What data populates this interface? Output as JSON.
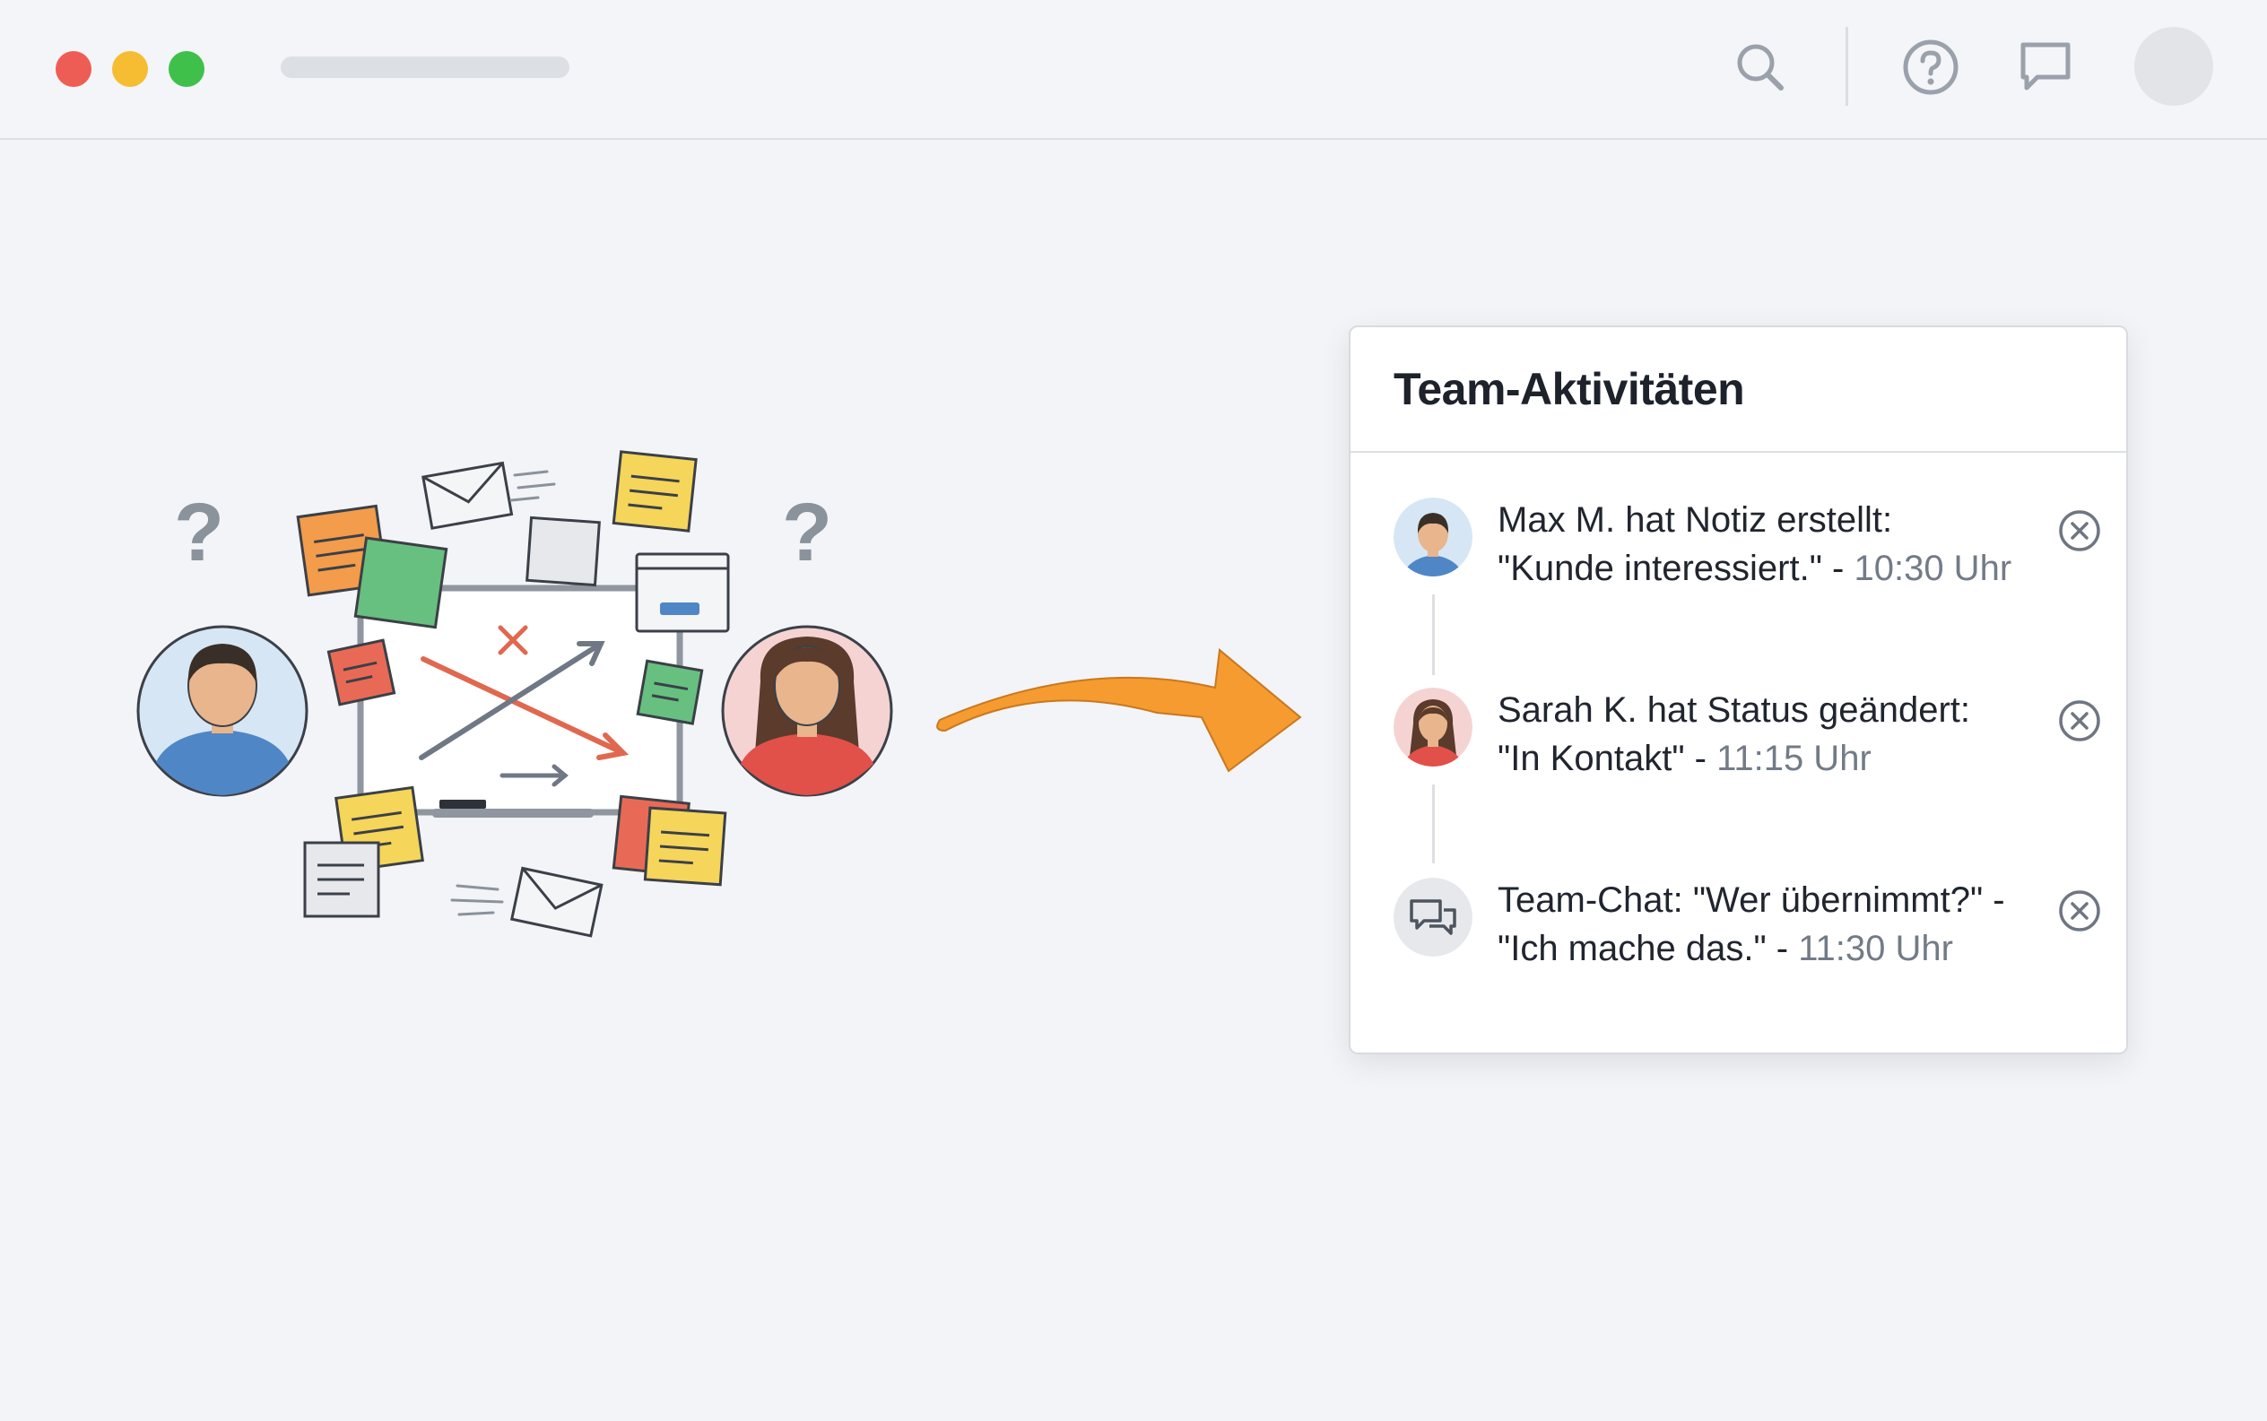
{
  "window": {
    "traffic_lights": {
      "close": "#ee5d55",
      "minimize": "#f6bd33",
      "maximize": "#3fc04b"
    },
    "toolbar_icons": [
      "search-icon",
      "help-icon",
      "chat-icon",
      "avatar"
    ]
  },
  "illustration": {
    "question_marks": [
      "?",
      "?"
    ],
    "colors": {
      "orange_arrow": "#f59b30",
      "red_arrow": "#e0684f",
      "grey_arrow": "#6f7884"
    }
  },
  "panel": {
    "title": "Team-Aktivitäten",
    "activities": [
      {
        "icon": "person-man-avatar",
        "line1": "Max M. hat Notiz erstellt:",
        "line2": "\"Kunde interessiert.\" - ",
        "time": "10:30 Uhr"
      },
      {
        "icon": "person-woman-avatar",
        "line1": "Sarah K. hat Status geändert:",
        "line2": "\"In Kontakt\" - ",
        "time": "11:15 Uhr"
      },
      {
        "icon": "chat-bubbles-icon",
        "line1": "Team-Chat: \"Wer übernimmt?\" -",
        "line2": "\"Ich mache das.\" - ",
        "time": "11:30 Uhr"
      }
    ]
  }
}
